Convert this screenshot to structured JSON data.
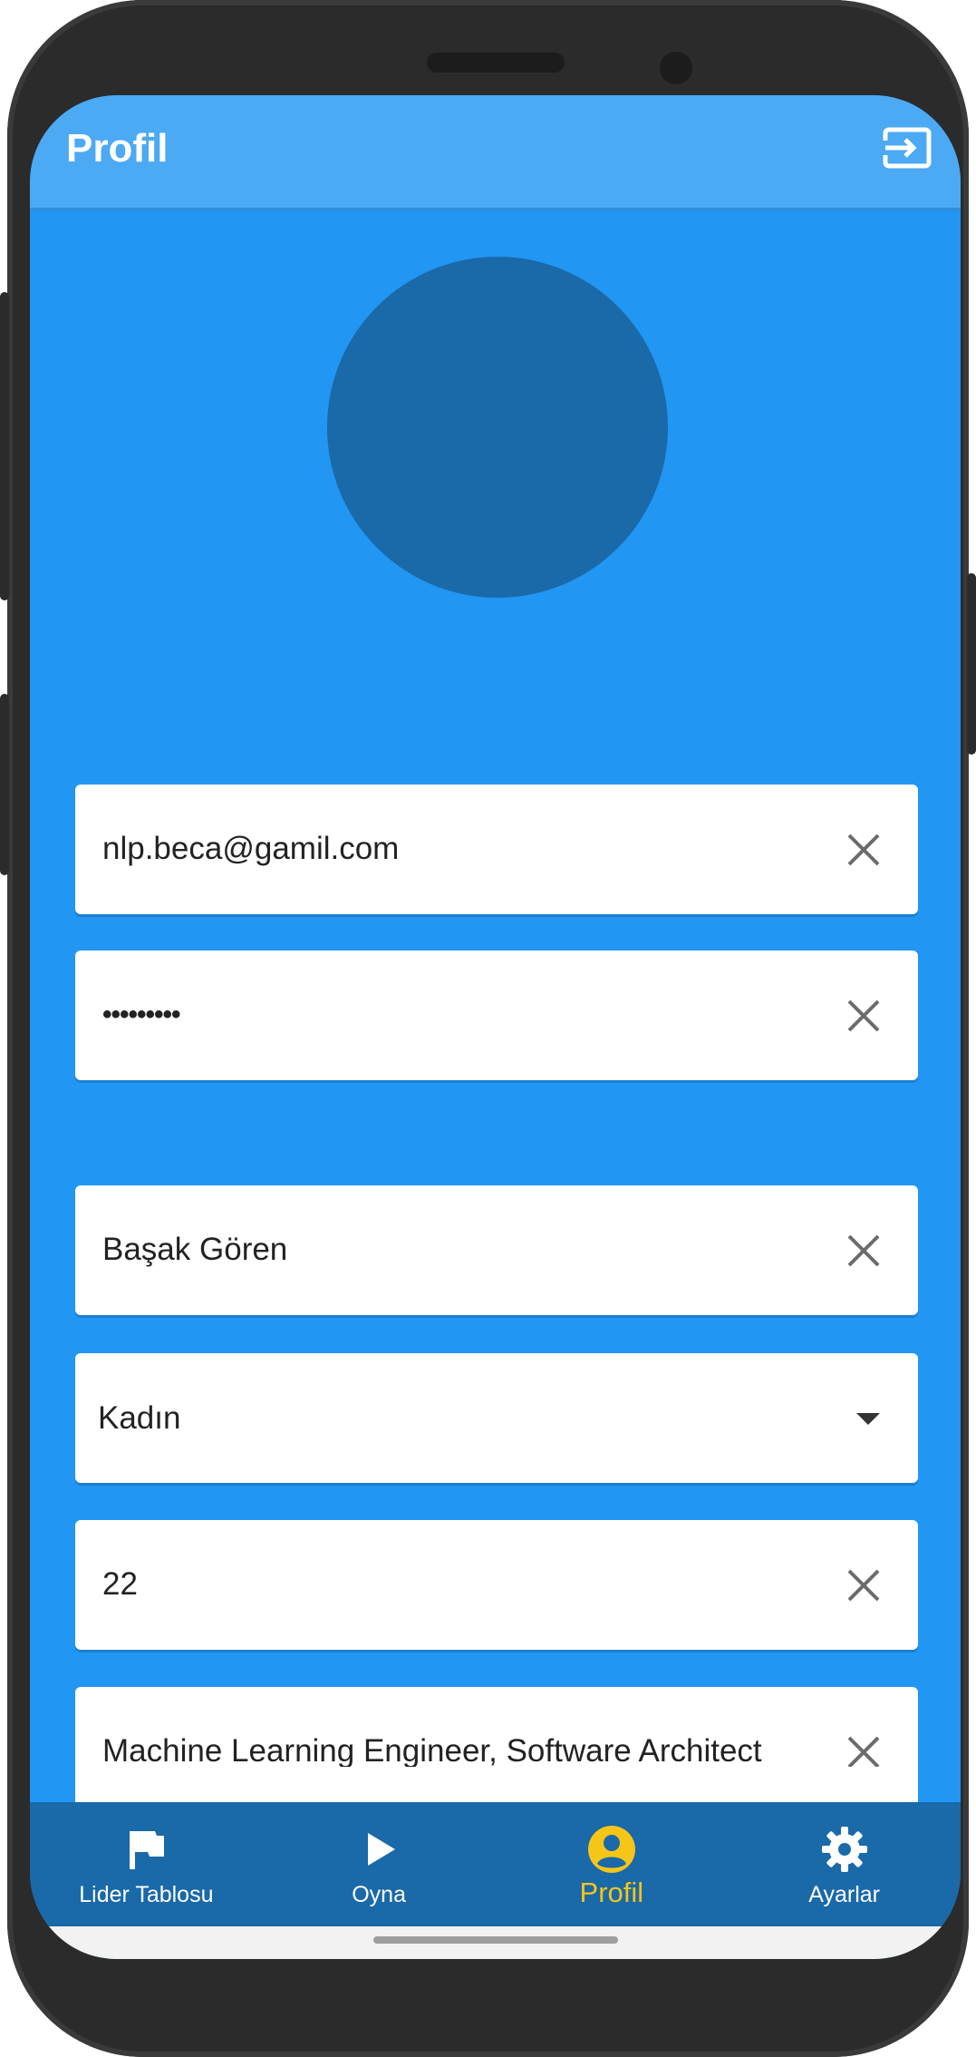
{
  "app_bar": {
    "title": "Profil",
    "logout_icon": "logout-icon"
  },
  "profile": {
    "avatar_color": "#1A69A9"
  },
  "fields": {
    "email": {
      "value": "nlp.beca@gamil.com"
    },
    "password": {
      "value": "•••••••••"
    },
    "name": {
      "value": "Başak Gören"
    },
    "gender": {
      "value": "Kadın"
    },
    "age": {
      "value": "22"
    },
    "occupation": {
      "value": "Machine Learning Engineer, Software Architect"
    }
  },
  "bottom_nav": {
    "items": [
      {
        "label": "Lider Tablosu",
        "icon": "flag-icon"
      },
      {
        "label": "Oyna",
        "icon": "play-icon"
      },
      {
        "label": "Profil",
        "icon": "account-circle-icon",
        "active": true
      },
      {
        "label": "Ayarlar",
        "icon": "gear-icon"
      }
    ]
  },
  "colors": {
    "background": "#2196F3",
    "app_bar": "#4CA9F3",
    "bottom_nav": "#1A69A9",
    "active_nav": "#F5C518"
  }
}
